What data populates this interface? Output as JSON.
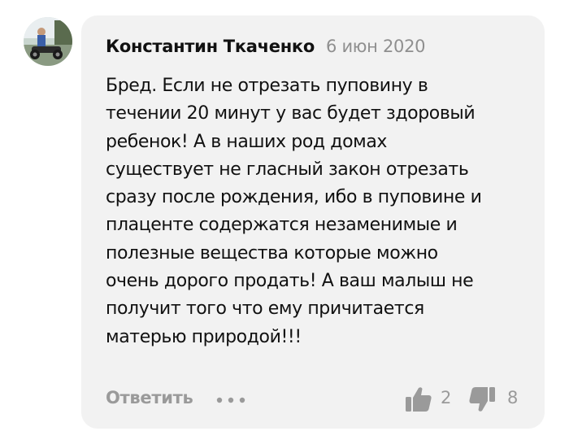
{
  "comment": {
    "author": "Константин Ткаченко",
    "date": "6 июн 2020",
    "text_lines": [
      "Бред. Если не отрезать пуповину в",
      "течении 20 минут у вас будет здоровый",
      "ребенок! А в наших род домах",
      "существует не гласный закон отрезать",
      "сразу после рождения, ибо в пуповине и",
      "плаценте содержатся незаменимые и",
      "полезные вещества которые можно",
      "очень дорого продать! А ваш малыш не",
      "получит того что ему причитается",
      "матерью природой!!!"
    ],
    "reply_label": "Ответить",
    "likes": "2",
    "dislikes": "8"
  },
  "icons": {
    "avatar": "avatar-photo",
    "more": "more-dots-icon",
    "like": "thumbs-up-icon",
    "dislike": "thumbs-down-icon"
  },
  "colors": {
    "bubble_bg": "#f2f2f2",
    "muted": "#9a9a9a",
    "text": "#111111"
  }
}
